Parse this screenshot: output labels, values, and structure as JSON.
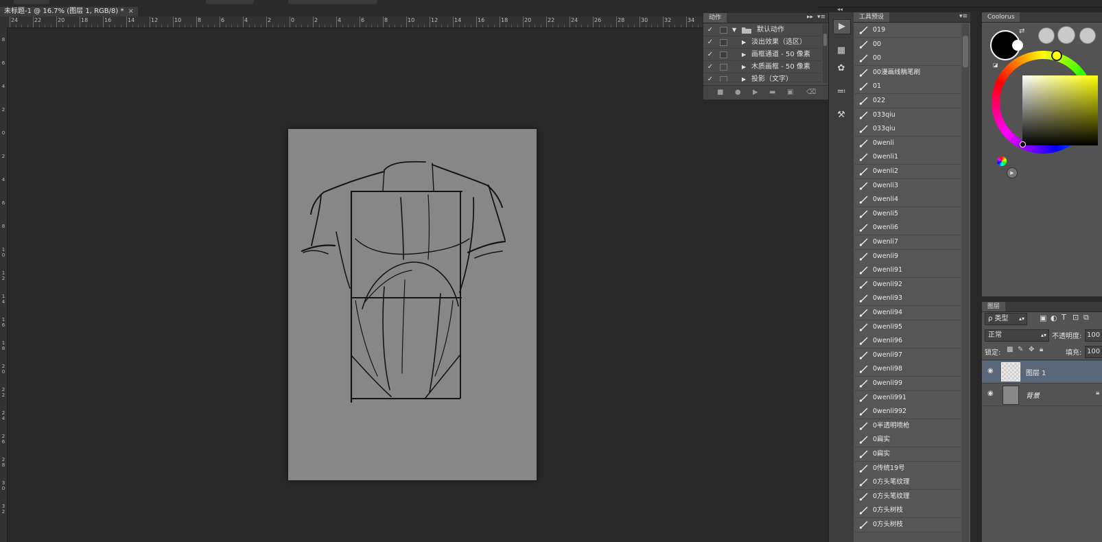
{
  "document": {
    "tab_title": "未标题-1 @ 16.7% (图层 1, RGB/8) *",
    "close_glyph": "×"
  },
  "ruler": {
    "horizontal_ticks": [
      "24",
      "22",
      "20",
      "18",
      "16",
      "14",
      "12",
      "10",
      "8",
      "6",
      "4",
      "2",
      "0",
      "2",
      "4",
      "6",
      "8",
      "10",
      "12",
      "14",
      "16",
      "18",
      "20",
      "22",
      "24",
      "26",
      "28",
      "30",
      "32",
      "34"
    ],
    "vertical_ticks": [
      "8",
      "6",
      "4",
      "2",
      "0",
      "2",
      "4",
      "6",
      "8",
      "1 0",
      "1 2",
      "1 4",
      "1 6",
      "1 8",
      "2 0",
      "2 2",
      "2 4",
      "2 6",
      "2 8",
      "3 0",
      "3 2"
    ]
  },
  "actions": {
    "tab_label": "动作",
    "expand_glyph": "▸▸",
    "menu_glyph": "▾≡",
    "items": [
      {
        "label": "默认动作",
        "checked": "✓",
        "type": "folder"
      },
      {
        "label": "淡出效果（选区）",
        "checked": "✓",
        "type": "action"
      },
      {
        "label": "画框通道 - 50 像素",
        "checked": "✓",
        "type": "action"
      },
      {
        "label": "木质画框 - 50 像素",
        "checked": "✓",
        "type": "action"
      },
      {
        "label": "投影（文字）",
        "checked": "✓",
        "type": "action"
      }
    ],
    "bottom_icons": [
      "stop-icon",
      "record-icon",
      "play-icon",
      "folder-icon",
      "new-action-icon",
      "trash-icon"
    ]
  },
  "dock": {
    "collapse_glyph": "◂◂",
    "icons": [
      "actions-play-icon",
      "navigator-icon",
      "color-palette-icon",
      "adjust-sliders-icon",
      "tool-presets-icon"
    ]
  },
  "presets": {
    "tab_label": "工具预设",
    "menu_glyph": "▾≡",
    "items": [
      "019",
      "00",
      "00",
      "00漫画线稿笔刷",
      "01",
      "022",
      "033qiu",
      "033qiu",
      "0wenli",
      "0wenli1",
      "0wenli2",
      "0wenli3",
      "0wenli4",
      "0wenli5",
      "0wenli6",
      "0wenli7",
      "0wenli9",
      "0wenli91",
      "0wenli92",
      "0wenli93",
      "0wenli94",
      "0wenli95",
      "0wenli96",
      "0wenli97",
      "0wenli98",
      "0wenli99",
      "0wenli991",
      "0wenli992",
      "0半透明喷枪",
      "0扁实",
      "0扁实",
      "0传统19号",
      "0方头笔纹理",
      "0方头笔纹理",
      "0方头树枝",
      "0方头树枝"
    ]
  },
  "coolorus": {
    "tab_label": "Coolorus",
    "foreground_color": "#000000",
    "background_color": "#ffffff",
    "selected_hue": "#ffff00"
  },
  "layers": {
    "tab_label": "图层",
    "filter_label": "ρ 类型",
    "blend_mode": "正常",
    "opacity_label": "不透明度:",
    "opacity_value": "100",
    "lock_label": "锁定:",
    "fill_label": "填充:",
    "fill_value": "100",
    "items": [
      {
        "name": "图层 1",
        "selected": true
      },
      {
        "name": "背景",
        "selected": false
      }
    ]
  },
  "colors": {
    "canvas_bg": "#282828",
    "document_bg": "#878787",
    "panel_bg": "#535353",
    "selected_layer": "#5a6779"
  }
}
